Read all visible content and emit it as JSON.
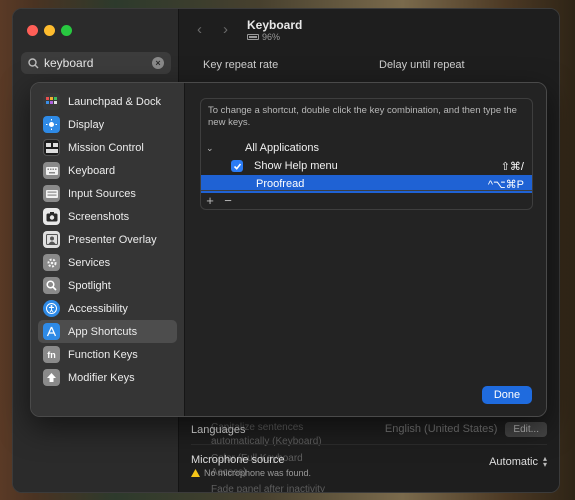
{
  "search": {
    "value": "keyboard"
  },
  "window": {
    "title": "Keyboard",
    "battery": "96%"
  },
  "columns": {
    "key_repeat": "Key repeat rate",
    "delay": "Delay until repeat"
  },
  "background": {
    "faint_text_1": "Capitalize sentences automatically (Keyboard)",
    "faint_text_2": "Color (Full Keyboard Access)",
    "faint_text_3": "Fade panel after inactivity",
    "languages_label": "Languages",
    "languages_value": "English (United States)",
    "edit_button": "Edit...",
    "microphone_label": "Microphone source",
    "microphone_warning": "No microphone was found.",
    "microphone_value": "Automatic"
  },
  "sidebar": {
    "items": [
      {
        "label": "Launchpad & Dock",
        "icon": "launchpad-dock-icon",
        "color": "#4a4a4a"
      },
      {
        "label": "Display",
        "icon": "display-icon",
        "color": "#2e8ae6"
      },
      {
        "label": "Mission Control",
        "icon": "mission-control-icon",
        "color": "#222222"
      },
      {
        "label": "Keyboard",
        "icon": "keyboard-icon",
        "color": "#7d7d7d"
      },
      {
        "label": "Input Sources",
        "icon": "input-sources-icon",
        "color": "#7d7d7d"
      },
      {
        "label": "Screenshots",
        "icon": "screenshots-icon",
        "color": "#3a3a3a"
      },
      {
        "label": "Presenter Overlay",
        "icon": "presenter-overlay-icon",
        "color": "#7d7d7d"
      },
      {
        "label": "Services",
        "icon": "services-icon",
        "color": "#7d7d7d"
      },
      {
        "label": "Spotlight",
        "icon": "spotlight-icon",
        "color": "#7d7d7d"
      },
      {
        "label": "Accessibility",
        "icon": "accessibility-icon",
        "color": "#2e8ae6"
      },
      {
        "label": "App Shortcuts",
        "icon": "app-shortcuts-icon",
        "color": "#2e8ae6"
      },
      {
        "label": "Function Keys",
        "icon": "function-keys-icon",
        "color": "#7d7d7d"
      },
      {
        "label": "Modifier Keys",
        "icon": "modifier-keys-icon",
        "color": "#7d7d7d"
      }
    ],
    "selected": "App Shortcuts"
  },
  "shortcuts": {
    "instructions": "To change a shortcut, double click the key combination, and then type the new keys.",
    "group": "All Applications",
    "rows": [
      {
        "label": "Show Help menu",
        "keys": "⇧⌘/",
        "checked": true
      },
      {
        "label": "Proofread",
        "keys": "^⌥⌘P",
        "selected": true
      }
    ],
    "add": "+",
    "remove": "−"
  },
  "done_button": "Done",
  "colors": {
    "accent": "#1f6bde",
    "selection": "#1f62d4",
    "close": "#ff5f57",
    "minimize": "#febc2e",
    "zoom": "#28c840",
    "warning": "#f5c518"
  }
}
